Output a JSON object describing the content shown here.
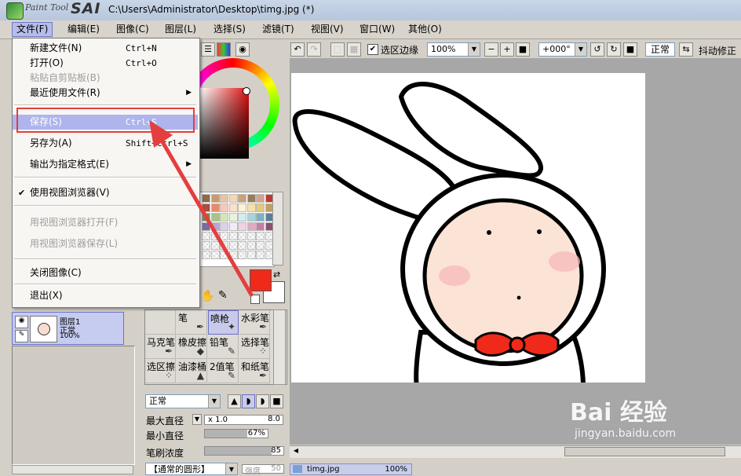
{
  "title_bar": {
    "logo_small": "Paint Tool",
    "logo_big": "SAI",
    "path": "C:\\Users\\Administrator\\Desktop\\timg.jpg (*)"
  },
  "menubar": [
    {
      "label": "文件(F)",
      "active": true
    },
    {
      "label": "编辑(E)"
    },
    {
      "label": "图像(C)"
    },
    {
      "label": "图层(L)"
    },
    {
      "label": "选择(S)"
    },
    {
      "label": "滤镜(T)"
    },
    {
      "label": "视图(V)"
    },
    {
      "label": "窗口(W)"
    },
    {
      "label": "其他(O)"
    }
  ],
  "file_menu": {
    "new": {
      "label": "新建文件(N)",
      "shortcut": "Ctrl+N"
    },
    "open": {
      "label": "打开(O)",
      "shortcut": "Ctrl+O"
    },
    "paste": {
      "label": "粘贴自剪贴板(B)"
    },
    "recent": {
      "label": "最近使用文件(R)"
    },
    "save": {
      "label": "保存(S)",
      "shortcut": "Ctrl+S"
    },
    "save_as": {
      "label": "另存为(A)",
      "shortcut": "Shift+Ctrl+S"
    },
    "export": {
      "label": "输出为指定格式(E)"
    },
    "use_viewer": {
      "label": "使用视图浏览器(V)",
      "check": "✔"
    },
    "viewer_open": {
      "label": "用视图浏览器打开(F)"
    },
    "viewer_save": {
      "label": "用视图浏览器保存(L)"
    },
    "close": {
      "label": "关闭图像(C)"
    },
    "exit": {
      "label": "退出(X)"
    }
  },
  "canvas_toolbar": {
    "selection_edge": "选区边缘",
    "zoom": "100%",
    "angle": "+000°",
    "blend": "正常",
    "stabilizer": "抖动修正"
  },
  "layer": {
    "name": "图层1",
    "mode": "正常",
    "opacity": "100%"
  },
  "brush_tools": [
    {
      "label": "",
      "icon": ""
    },
    {
      "label": "笔",
      "icon": "✒"
    },
    {
      "label": "喷枪",
      "icon": "✦",
      "selected": true
    },
    {
      "label": "水彩笔",
      "icon": "✒"
    },
    {
      "label": "马克笔",
      "icon": "✒"
    },
    {
      "label": "橡皮擦",
      "icon": "◆"
    },
    {
      "label": "铅笔",
      "icon": "✎"
    },
    {
      "label": "选择笔",
      "icon": "⁘"
    },
    {
      "label": "选区擦",
      "icon": "⁘"
    },
    {
      "label": "油漆桶",
      "icon": "▲"
    },
    {
      "label": "2值笔",
      "icon": "✎"
    },
    {
      "label": "和纸笔",
      "icon": "✒"
    }
  ],
  "brush_settings": {
    "blend": "正常",
    "max_size_label": "最大直径",
    "max_size_mult": "x 1.0",
    "max_size_val": "8.0",
    "min_size_label": "最小直径",
    "min_size_val": "67%",
    "min_size_frac": 0.67,
    "density_label": "笔刷浓度",
    "density_val": "85",
    "density_frac": 0.85,
    "shape": "【通常的圆形】",
    "strength": "强度",
    "strength_val": "50"
  },
  "colors": {
    "fg": "#f02a1a",
    "bg": "#ffffff",
    "accent": "#aeb4ec",
    "annotation": "#e53e3e"
  },
  "palette": [
    [
      "#8b6b4a",
      "#c89b6a",
      "#e8c4a0",
      "#f2d6b5",
      "#c8a27a",
      "#9a7b5c",
      "#d9a08c",
      "#c0392b"
    ],
    [
      "#a94f3b",
      "#e58a6e",
      "#f7c8b8",
      "#fbe0c8",
      "#fff1d6",
      "#f7e2a6",
      "#e3c97a",
      "#c0a060"
    ],
    [
      "#6a8f4e",
      "#a8c48a",
      "#d4e6b5",
      "#eaf3d8",
      "#d2ecef",
      "#a9d3dc",
      "#7fb0c2",
      "#5a7f99"
    ],
    [
      "#7a6aa8",
      "#b7a6d6",
      "#dcd0ee",
      "#f3eaf7",
      "#f2d1e0",
      "#e1a9c4",
      "#c77ea4",
      "#8c4f73"
    ]
  ],
  "document_tab": {
    "name": "timg.jpg",
    "zoom": "100%"
  },
  "watermark": {
    "brand": "Bai 经验",
    "url": "jingyan.baidu.com"
  }
}
